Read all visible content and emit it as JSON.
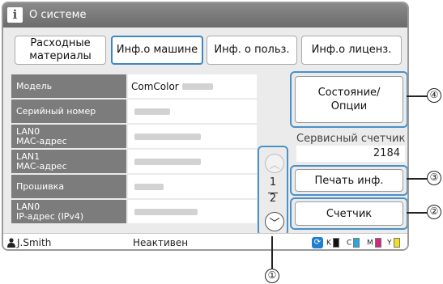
{
  "window": {
    "title": "О системе"
  },
  "tabs": [
    {
      "label": "Расходные материалы",
      "active": false
    },
    {
      "label": "Инф.о машине",
      "active": true
    },
    {
      "label": "Инф. о польз.",
      "active": false
    },
    {
      "label": "Инф.о лиценз.",
      "active": false
    }
  ],
  "info_rows": [
    {
      "label": "Модель",
      "value": "ComColor"
    },
    {
      "label": "Серийный номер",
      "value": ""
    },
    {
      "label_line1": "LAN0",
      "label_line2": "MAC-адрес",
      "value": ""
    },
    {
      "label_line1": "LAN1",
      "label_line2": "MAC-адрес",
      "value": ""
    },
    {
      "label": "Прошивка",
      "value": ""
    },
    {
      "label_line1": "LAN0",
      "label_line2": "IP-адрес (IPv4)",
      "value": ""
    }
  ],
  "pager": {
    "current": "1",
    "total": "2"
  },
  "buttons": {
    "status_options": "Состояние/ Опции",
    "print_info": "Печать инф.",
    "counter": "Счетчик"
  },
  "service_counter": {
    "label": "Сервисный счетчик",
    "value": "2184"
  },
  "statusbar": {
    "user": "J.Smith",
    "status": "Неактивен",
    "inks": [
      {
        "letter": "K",
        "color": "#111111"
      },
      {
        "letter": "C",
        "color": "#29a8e0"
      },
      {
        "letter": "M",
        "color": "#d6257d"
      },
      {
        "letter": "Y",
        "color": "#f3dd1c"
      }
    ]
  },
  "callouts": [
    "①",
    "②",
    "③",
    "④"
  ],
  "colors": {
    "accent": "#4a91c7",
    "titlebar": "#7a7a7a",
    "label_bg": "#7c7c7c"
  }
}
